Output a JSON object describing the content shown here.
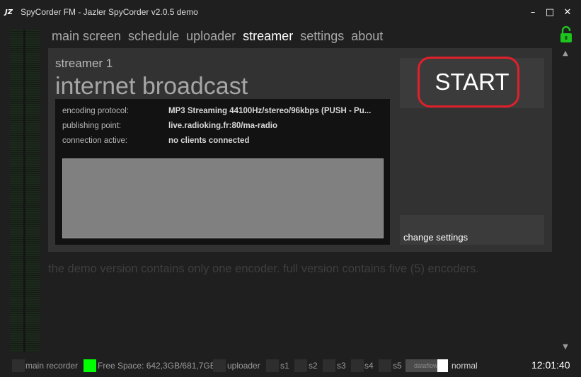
{
  "window": {
    "logo_text": "JZ",
    "title": "SpyCorder FM - Jazler SpyCorder v2.0.5 demo",
    "minimize_icon": "–",
    "maximize_icon": "□",
    "close_icon": "✕"
  },
  "nav": {
    "items": [
      "main screen",
      "schedule",
      "uploader",
      "streamer",
      "settings",
      "about"
    ],
    "active": "streamer"
  },
  "streamer": {
    "name": "streamer 1",
    "type": "internet broadcast",
    "info": [
      {
        "label": "encoding protocol:",
        "value": "MP3 Streaming 44100Hz/stereo/96kbps (PUSH - Pu..."
      },
      {
        "label": "publishing point:",
        "value": "live.radioking.fr:80/ma-radio"
      },
      {
        "label": "connection active:",
        "value": "no clients connected"
      }
    ],
    "start_label": "START",
    "change_settings_label": "change settings"
  },
  "demo_note": "the demo version contains only one encoder. full version contains five (5) encoders.",
  "status_bar": {
    "main_recorder": "main recorder",
    "free_space": "Free Space: 642,3GB/681,7GB",
    "uploader": "uploader",
    "s1": "s1",
    "s2": "s2",
    "s3": "s3",
    "s4": "s4",
    "s5": "s5",
    "dataflow": "dataflow",
    "mode": "normal",
    "clock": "12:01:40"
  },
  "colors": {
    "free_space_indicator": "#00ff00",
    "start_highlight": "#e0202a",
    "lock_icon": "#1ec41e"
  },
  "icons": {
    "lock": "lock-open-icon",
    "scroll_up": "▲",
    "scroll_down": "▼"
  }
}
